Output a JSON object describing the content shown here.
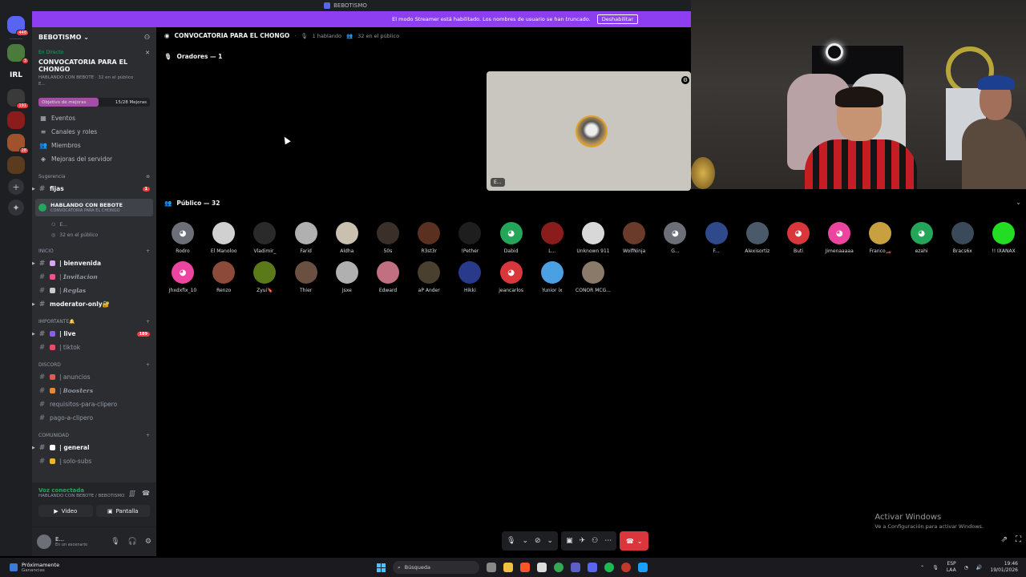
{
  "window": {
    "title": "BEBOTISMO"
  },
  "streamer_banner": {
    "message": "El modo Streamer está habilitado. Los nombres de usuario se han truncado.",
    "button": "Deshabilitar"
  },
  "rail": {
    "servers": [
      {
        "label": "",
        "badge": "448",
        "color": "#5865f2"
      },
      {
        "label": "",
        "badge": "3",
        "color": "#4a7a3c"
      },
      {
        "label": "IRL",
        "badge": "",
        "color": "#1e1f22"
      },
      {
        "label": "",
        "badge": "191",
        "color": "#3a3a3a"
      },
      {
        "label": "",
        "badge": "",
        "color": "#8b1c1c"
      },
      {
        "label": "",
        "badge": "28",
        "color": "#a0522d"
      },
      {
        "label": "",
        "badge": "",
        "color": "#5a3b1e"
      }
    ]
  },
  "sidebar": {
    "server_name": "BEBOTISMO",
    "live_tag": "En Directo",
    "live_title": "CONVOCATORIA PARA EL CHONGO",
    "live_sub": "HABLANDO CON BEBOTE · 32 en el público",
    "live_sub2": "E...",
    "boost_label": "Objetivo de mejoras",
    "boost_count": "15/28 Mejoras",
    "boost_progress": 0.54,
    "menu": [
      {
        "icon": "calendar-icon",
        "glyph": "▦",
        "label": "Eventos"
      },
      {
        "icon": "channels-icon",
        "glyph": "≡",
        "label": "Canales y roles"
      },
      {
        "icon": "members-icon",
        "glyph": "👥",
        "label": "Miembros"
      },
      {
        "icon": "boost-icon",
        "glyph": "◈",
        "label": "Mejoras del servidor"
      }
    ],
    "suggestion_cat": "Sugerencia",
    "fijas": {
      "name": "fijas",
      "count": "1"
    },
    "voice_channel": {
      "name": "HABLANDO CON BEBOTE",
      "sub": "CONVOCATORIA PARA EL CHONGO"
    },
    "voice_users": [
      "E...",
      "32 en el público"
    ],
    "cat_inicio": "INICIO",
    "inicio_channels": [
      {
        "name": "| bienvenida",
        "bold": true,
        "emoji": "#d9a3f2"
      },
      {
        "name": "| 𝙄𝙣𝙫𝙞𝙩𝙖𝙘𝙞𝙤𝙣",
        "bold": false,
        "emoji": "#e05a8c"
      },
      {
        "name": "| 𝙍𝙚𝙜𝙡𝙖𝙨",
        "bold": false,
        "emoji": "#cccccc"
      }
    ],
    "moderator": "moderator-only🔐",
    "cat_importante": "IMPORTANTE🔔",
    "importante_channels": [
      {
        "name": "| live",
        "bold": true,
        "emoji": "#8a5cf6",
        "count": "189"
      },
      {
        "name": "| tiktok",
        "bold": false,
        "emoji": "#e04e6a",
        "count": ""
      }
    ],
    "cat_discord": "DISCORD",
    "discord_channels": [
      {
        "name": "| anuncios",
        "bold": false,
        "emoji": "#e05a5a"
      },
      {
        "name": "| 𝘽𝙤𝙤𝙨𝙩𝙚𝙧𝙨",
        "bold": false,
        "emoji": "#e58a3a"
      },
      {
        "name": "requisitos-para-clipero",
        "bold": false,
        "emoji": ""
      },
      {
        "name": "pago-a-clipero",
        "bold": false,
        "emoji": ""
      }
    ],
    "cat_comunidad": "COMUNIDAD",
    "comunidad_channels": [
      {
        "name": "| general",
        "bold": true,
        "emoji": "#ffffff"
      },
      {
        "name": "| solo-subs",
        "bold": false,
        "emoji": "#f0b232"
      }
    ]
  },
  "voicebar": {
    "status": "Voz conectada",
    "channel": "HABLANDO CON BEBOTE / BEBOTISMO",
    "video": "Video",
    "screen": "Pantalla"
  },
  "userbar": {
    "name": "E...",
    "status": "En un escenario"
  },
  "header": {
    "channel": "CONVOCATORIA PARA EL CHONGO",
    "speaking": "1 hablando",
    "audience": "32 en el público"
  },
  "speakers": {
    "label": "Oradores — 1",
    "tile_tag": "E..."
  },
  "audience": {
    "label": "Público — 32",
    "row1": [
      {
        "name": "Rodro",
        "color": "#6d6f78",
        "glyph": "◕"
      },
      {
        "name": "El Manoloo",
        "color": "#d0d0d0",
        "glyph": ""
      },
      {
        "name": "Vladimir_",
        "color": "#2a2a2a",
        "glyph": ""
      },
      {
        "name": "Farid",
        "color": "#b0b0b0",
        "glyph": ""
      },
      {
        "name": "Aldha",
        "color": "#c9c0b0",
        "glyph": ""
      },
      {
        "name": "50s",
        "color": "#3b2f2a",
        "glyph": ""
      },
      {
        "name": "R3st3r",
        "color": "#5a3020",
        "glyph": ""
      },
      {
        "name": "!Pether",
        "color": "#1e1e1e",
        "glyph": ""
      },
      {
        "name": "Dabid",
        "color": "#23a55a",
        "glyph": "◕"
      },
      {
        "name": "L...",
        "color": "#8b1c1c",
        "glyph": ""
      },
      {
        "name": "Unknown 911",
        "color": "#d8d8d8",
        "glyph": ""
      },
      {
        "name": "WolfNinja",
        "color": "#6a3a2a",
        "glyph": ""
      },
      {
        "name": "G...",
        "color": "#6d6f78",
        "glyph": "◕"
      },
      {
        "name": "F...",
        "color": "#2e4a8a",
        "glyph": ""
      },
      {
        "name": "Alexisortiz",
        "color": "#4a5a6a",
        "glyph": ""
      },
      {
        "name": "Buti",
        "color": "#da373c",
        "glyph": "◕"
      },
      {
        "name": "Jimenaaaaa",
        "color": "#eb459f",
        "glyph": "◕"
      },
      {
        "name": "Franco🏎️",
        "color": "#c9a040",
        "glyph": ""
      },
      {
        "name": "ezahi",
        "color": "#23a55a",
        "glyph": "◕"
      },
      {
        "name": "Bracs6x",
        "color": "#3a4a5a",
        "glyph": ""
      },
      {
        "name": "!! IXANAX",
        "color": "#22dd22",
        "glyph": ""
      }
    ],
    "row2": [
      {
        "name": "Jhxdxfix_10",
        "color": "#eb459f",
        "glyph": "◕"
      },
      {
        "name": "Renzo",
        "color": "#8b4a3a",
        "glyph": ""
      },
      {
        "name": "Zyui🔖",
        "color": "#5a7a1a",
        "glyph": ""
      },
      {
        "name": "Thier",
        "color": "#6a5040",
        "glyph": ""
      },
      {
        "name": "Jsxe",
        "color": "#b0b0b0",
        "glyph": ""
      },
      {
        "name": "Edward",
        "color": "#c07080",
        "glyph": ""
      },
      {
        "name": "aP Ander",
        "color": "#4a4030",
        "glyph": ""
      },
      {
        "name": "Hikki",
        "color": "#2a3a8a",
        "glyph": ""
      },
      {
        "name": "jeancarlos",
        "color": "#da373c",
        "glyph": "◕"
      },
      {
        "name": "Yunior ix",
        "color": "#4aa0e0",
        "glyph": ""
      },
      {
        "name": "CONOR MCG...",
        "color": "#8a7a6a",
        "glyph": ""
      }
    ]
  },
  "watermark": {
    "title": "Activar Windows",
    "sub": "Ve a Configuración para activar Windows."
  },
  "taskbar": {
    "news_title": "Próximamente",
    "news_sub": "Ganancias",
    "search_placeholder": "Búsqueda",
    "lang": "ESP",
    "lang2": "LAA",
    "time": "19:46",
    "date": "19/01/2026"
  }
}
